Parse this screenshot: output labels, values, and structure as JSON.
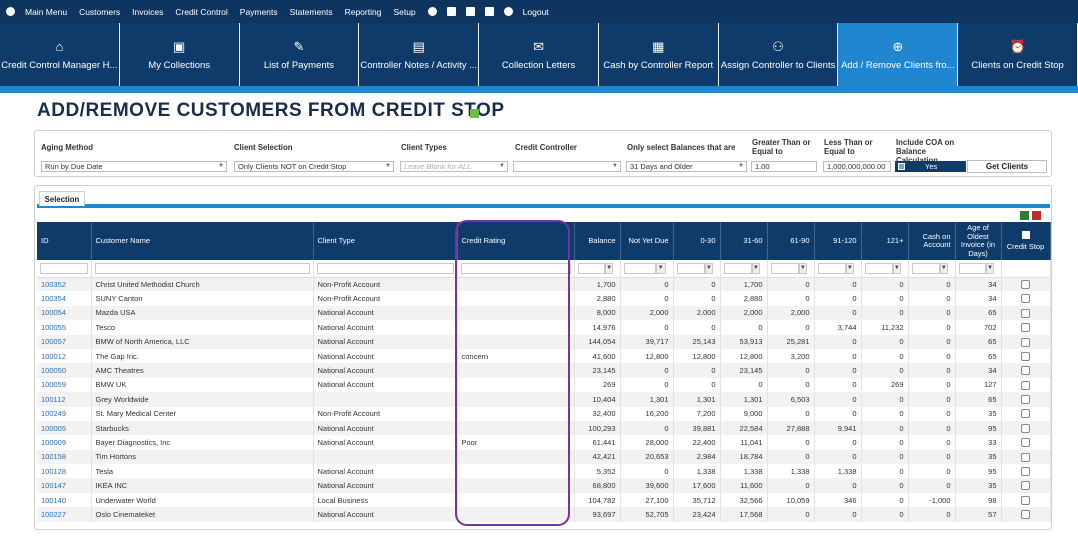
{
  "menu": {
    "items": [
      "Main Menu",
      "Customers",
      "Invoices",
      "Credit Control",
      "Payments",
      "Statements",
      "Reporting",
      "Setup"
    ],
    "logout": "Logout"
  },
  "tiles": [
    {
      "label": "Credit Control Manager H...",
      "icon": "home-icon",
      "glyph": "⌂"
    },
    {
      "label": "My Collections",
      "icon": "collections-icon",
      "glyph": "▣"
    },
    {
      "label": "List of Payments",
      "icon": "edit-icon",
      "glyph": "✎"
    },
    {
      "label": "Controller Notes / Activity ...",
      "icon": "notes-icon",
      "glyph": "▤"
    },
    {
      "label": "Collection Letters",
      "icon": "letters-icon",
      "glyph": "✉"
    },
    {
      "label": "Cash by Controller Report",
      "icon": "report-icon",
      "glyph": "▦"
    },
    {
      "label": "Assign Controller to Clients",
      "icon": "assign-icon",
      "glyph": "⚇"
    },
    {
      "label": "Add / Remove Clients fro...",
      "icon": "add-remove-icon",
      "glyph": "⊕",
      "active": true
    },
    {
      "label": "Clients on Credit Stop",
      "icon": "alarm-icon",
      "glyph": "⏰"
    }
  ],
  "page": {
    "title": "ADD/REMOVE CUSTOMERS FROM CREDIT STOP"
  },
  "filters": {
    "aging_method": {
      "label": "Aging Method",
      "value": "Run by Due Date"
    },
    "client_selection": {
      "label": "Client Selection",
      "value": "Only Clients NOT on Credit Stop"
    },
    "client_types": {
      "label": "Client Types",
      "placeholder": "Leave Blank for ALL"
    },
    "credit_controller": {
      "label": "Credit Controller",
      "value": ""
    },
    "balances": {
      "label": "Only select Balances that are",
      "value": "31 Days and Older"
    },
    "greater_than": {
      "label": "Greater Than or Equal to",
      "value": "1.00"
    },
    "less_than": {
      "label": "Less Than or Equal to",
      "value": "1,000,000,000.00"
    },
    "include_coa": {
      "label": "Include COA on Balance Calculation",
      "value": "Yes"
    },
    "get_clients": "Get Clients"
  },
  "selection": {
    "tab": "Selection",
    "columns": [
      "ID",
      "Customer Name",
      "Client Type",
      "Credit Rating",
      "Balance",
      "Not Yet Due",
      "0-30",
      "31-60",
      "61-90",
      "91-120",
      "121+",
      "Cash on Account",
      "Age of Oldest Invoice (in Days)",
      "Credit Stop"
    ],
    "rows": [
      [
        "100352",
        "Christ United Methodist Church",
        "Non-Profit Account",
        "",
        "1,700",
        "0",
        "0",
        "1,700",
        "0",
        "0",
        "0",
        "0",
        "34"
      ],
      [
        "100354",
        "SUNY Canton",
        "Non-Profit Account",
        "",
        "2,880",
        "0",
        "0",
        "2,880",
        "0",
        "0",
        "0",
        "0",
        "34"
      ],
      [
        "100054",
        "Mazda USA",
        "National Account",
        "",
        "8,000",
        "2,000",
        "2,000",
        "2,000",
        "2,000",
        "0",
        "0",
        "0",
        "65"
      ],
      [
        "100055",
        "Tesco",
        "National Account",
        "",
        "14,976",
        "0",
        "0",
        "0",
        "0",
        "3,744",
        "11,232",
        "0",
        "702"
      ],
      [
        "100057",
        "BMW of North America, LLC",
        "National Account",
        "",
        "144,054",
        "39,717",
        "25,143",
        "53,913",
        "25,281",
        "0",
        "0",
        "0",
        "65"
      ],
      [
        "100012",
        "The Gap Inc.",
        "National Account",
        "concern",
        "41,600",
        "12,800",
        "12,800",
        "12,800",
        "3,200",
        "0",
        "0",
        "0",
        "65"
      ],
      [
        "100050",
        "AMC Theatres",
        "National Account",
        "",
        "23,145",
        "0",
        "0",
        "23,145",
        "0",
        "0",
        "0",
        "0",
        "34"
      ],
      [
        "100059",
        "BMW UK",
        "National Account",
        "",
        "269",
        "0",
        "0",
        "0",
        "0",
        "0",
        "269",
        "0",
        "127"
      ],
      [
        "100112",
        "Grey Worldwide",
        "",
        "",
        "10,404",
        "1,301",
        "1,301",
        "1,301",
        "6,503",
        "0",
        "0",
        "0",
        "65"
      ],
      [
        "100249",
        "St. Mary Medical Center",
        "Non-Profit Account",
        "",
        "32,400",
        "16,200",
        "7,200",
        "9,000",
        "0",
        "0",
        "0",
        "0",
        "35"
      ],
      [
        "100005",
        "Starbucks",
        "National Account",
        "",
        "100,293",
        "0",
        "39,881",
        "22,584",
        "27,888",
        "9,941",
        "0",
        "0",
        "95"
      ],
      [
        "100009",
        "Bayer Diagnostics, Inc",
        "National Account",
        "Poor",
        "61,441",
        "28,000",
        "22,400",
        "11,041",
        "0",
        "0",
        "0",
        "0",
        "33"
      ],
      [
        "100158",
        "Tim Hortons",
        "",
        "",
        "42,421",
        "20,653",
        "2,984",
        "18,784",
        "0",
        "0",
        "0",
        "0",
        "35"
      ],
      [
        "100128",
        "Tesla",
        "National Account",
        "",
        "5,352",
        "0",
        "1,338",
        "1,338",
        "1,338",
        "1,338",
        "0",
        "0",
        "95"
      ],
      [
        "100147",
        "IKEA INC",
        "National Account",
        "",
        "68,800",
        "39,600",
        "17,600",
        "11,600",
        "0",
        "0",
        "0",
        "0",
        "35"
      ],
      [
        "100140",
        "Underwater World",
        "Local Business",
        "",
        "104,782",
        "27,100",
        "35,712",
        "32,566",
        "10,059",
        "346",
        "0",
        "-1,000",
        "98"
      ],
      [
        "100227",
        "Oslo Cinemateket",
        "National Account",
        "",
        "93,697",
        "52,705",
        "23,424",
        "17,568",
        "0",
        "0",
        "0",
        "0",
        "57"
      ]
    ]
  },
  "colors": {
    "navy": "#0f3b6a",
    "accent": "#1f86cf",
    "highlight": "#7b2fa0"
  }
}
